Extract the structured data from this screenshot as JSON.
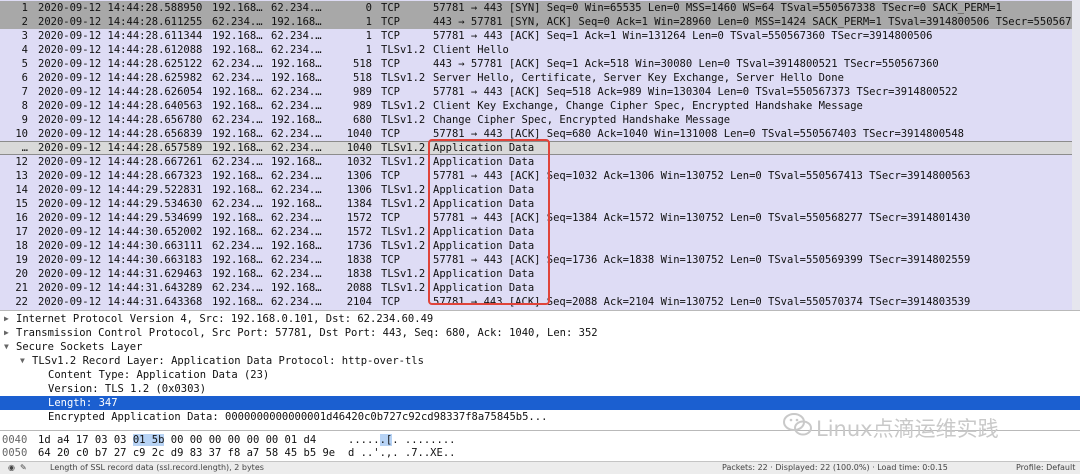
{
  "packets": [
    {
      "no": "1",
      "time": "2020-09-12 14:44:28.588950",
      "src": "192.168…",
      "dst": "62.234.…",
      "len": "0",
      "proto": "TCP",
      "info": "57781 → 443 [SYN] Seq=0 Win=65535 Len=0 MSS=1460 WS=64 TSval=550567338 TSecr=0 SACK_PERM=1",
      "style": "syn"
    },
    {
      "no": "2",
      "time": "2020-09-12 14:44:28.611255",
      "src": "62.234.…",
      "dst": "192.168…",
      "len": "1",
      "proto": "TCP",
      "info": "443 → 57781 [SYN, ACK] Seq=0 Ack=1 Win=28960 Len=0 MSS=1424 SACK_PERM=1 TSval=3914800506 TSecr=550567338",
      "style": "syn"
    },
    {
      "no": "3",
      "time": "2020-09-12 14:44:28.611344",
      "src": "192.168…",
      "dst": "62.234.…",
      "len": "1",
      "proto": "TCP",
      "info": "57781 → 443 [ACK] Seq=1 Ack=1 Win=131264 Len=0 TSval=550567360 TSecr=3914800506",
      "style": ""
    },
    {
      "no": "4",
      "time": "2020-09-12 14:44:28.612088",
      "src": "192.168…",
      "dst": "62.234.…",
      "len": "1",
      "proto": "TLSv1.2",
      "info": "Client Hello",
      "style": ""
    },
    {
      "no": "5",
      "time": "2020-09-12 14:44:28.625122",
      "src": "62.234.…",
      "dst": "192.168…",
      "len": "518",
      "proto": "TCP",
      "info": "443 → 57781 [ACK] Seq=1 Ack=518 Win=30080 Len=0 TSval=3914800521 TSecr=550567360",
      "style": ""
    },
    {
      "no": "6",
      "time": "2020-09-12 14:44:28.625982",
      "src": "62.234.…",
      "dst": "192.168…",
      "len": "518",
      "proto": "TLSv1.2",
      "info": "Server Hello, Certificate, Server Key Exchange, Server Hello Done",
      "style": ""
    },
    {
      "no": "7",
      "time": "2020-09-12 14:44:28.626054",
      "src": "192.168…",
      "dst": "62.234.…",
      "len": "989",
      "proto": "TCP",
      "info": "57781 → 443 [ACK] Seq=518 Ack=989 Win=130304 Len=0 TSval=550567373 TSecr=3914800522",
      "style": ""
    },
    {
      "no": "8",
      "time": "2020-09-12 14:44:28.640563",
      "src": "192.168…",
      "dst": "62.234.…",
      "len": "989",
      "proto": "TLSv1.2",
      "info": "Client Key Exchange, Change Cipher Spec, Encrypted Handshake Message",
      "style": ""
    },
    {
      "no": "9",
      "time": "2020-09-12 14:44:28.656780",
      "src": "62.234.…",
      "dst": "192.168…",
      "len": "680",
      "proto": "TLSv1.2",
      "info": "Change Cipher Spec, Encrypted Handshake Message",
      "style": ""
    },
    {
      "no": "10",
      "time": "2020-09-12 14:44:28.656839",
      "src": "192.168…",
      "dst": "62.234.…",
      "len": "1040",
      "proto": "TCP",
      "info": "57781 → 443 [ACK] Seq=680 Ack=1040 Win=131008 Len=0 TSval=550567403 TSecr=3914800548",
      "style": ""
    },
    {
      "no": "…",
      "time": "2020-09-12 14:44:28.657589",
      "src": "192.168…",
      "dst": "62.234.…",
      "len": "1040",
      "proto": "TLSv1.2",
      "info": "Application Data",
      "style": "sel"
    },
    {
      "no": "12",
      "time": "2020-09-12 14:44:28.667261",
      "src": "62.234.…",
      "dst": "192.168…",
      "len": "1032",
      "proto": "TLSv1.2",
      "info": "Application Data",
      "style": ""
    },
    {
      "no": "13",
      "time": "2020-09-12 14:44:28.667323",
      "src": "192.168…",
      "dst": "62.234.…",
      "len": "1306",
      "proto": "TCP",
      "info": "57781 → 443 [ACK] Seq=1032 Ack=1306 Win=130752 Len=0 TSval=550567413 TSecr=3914800563",
      "style": ""
    },
    {
      "no": "14",
      "time": "2020-09-12 14:44:29.522831",
      "src": "192.168…",
      "dst": "62.234.…",
      "len": "1306",
      "proto": "TLSv1.2",
      "info": "Application Data",
      "style": ""
    },
    {
      "no": "15",
      "time": "2020-09-12 14:44:29.534630",
      "src": "62.234.…",
      "dst": "192.168…",
      "len": "1384",
      "proto": "TLSv1.2",
      "info": "Application Data",
      "style": ""
    },
    {
      "no": "16",
      "time": "2020-09-12 14:44:29.534699",
      "src": "192.168…",
      "dst": "62.234.…",
      "len": "1572",
      "proto": "TCP",
      "info": "57781 → 443 [ACK] Seq=1384 Ack=1572 Win=130752 Len=0 TSval=550568277 TSecr=3914801430",
      "style": ""
    },
    {
      "no": "17",
      "time": "2020-09-12 14:44:30.652002",
      "src": "192.168…",
      "dst": "62.234.…",
      "len": "1572",
      "proto": "TLSv1.2",
      "info": "Application Data",
      "style": ""
    },
    {
      "no": "18",
      "time": "2020-09-12 14:44:30.663111",
      "src": "62.234.…",
      "dst": "192.168…",
      "len": "1736",
      "proto": "TLSv1.2",
      "info": "Application Data",
      "style": ""
    },
    {
      "no": "19",
      "time": "2020-09-12 14:44:30.663183",
      "src": "192.168…",
      "dst": "62.234.…",
      "len": "1838",
      "proto": "TCP",
      "info": "57781 → 443 [ACK] Seq=1736 Ack=1838 Win=130752 Len=0 TSval=550569399 TSecr=3914802559",
      "style": ""
    },
    {
      "no": "20",
      "time": "2020-09-12 14:44:31.629463",
      "src": "192.168…",
      "dst": "62.234.…",
      "len": "1838",
      "proto": "TLSv1.2",
      "info": "Application Data",
      "style": ""
    },
    {
      "no": "21",
      "time": "2020-09-12 14:44:31.643289",
      "src": "62.234.…",
      "dst": "192.168…",
      "len": "2088",
      "proto": "TLSv1.2",
      "info": "Application Data",
      "style": ""
    },
    {
      "no": "22",
      "time": "2020-09-12 14:44:31.643368",
      "src": "192.168…",
      "dst": "62.234.…",
      "len": "2104",
      "proto": "TCP",
      "info": "57781 → 443 [ACK] Seq=2088 Ack=2104 Win=130752 Len=0 TSval=550570374 TSecr=3914803539",
      "style": ""
    }
  ],
  "details": [
    {
      "text": "Internet Protocol Version 4, Src: 192.168.0.101, Dst: 62.234.60.49",
      "level": 0,
      "tri": "▶",
      "selected": false
    },
    {
      "text": "Transmission Control Protocol, Src Port: 57781, Dst Port: 443, Seq: 680, Ack: 1040, Len: 352",
      "level": 0,
      "tri": "▶",
      "selected": false
    },
    {
      "text": "Secure Sockets Layer",
      "level": 0,
      "tri": "▼",
      "selected": false
    },
    {
      "text": "TLSv1.2 Record Layer: Application Data Protocol: http-over-tls",
      "level": 1,
      "tri": "▼",
      "selected": false
    },
    {
      "text": "Content Type: Application Data (23)",
      "level": 2,
      "tri": "",
      "selected": false
    },
    {
      "text": "Version: TLS 1.2 (0x0303)",
      "level": 2,
      "tri": "",
      "selected": false
    },
    {
      "text": "Length: 347",
      "level": 2,
      "tri": "",
      "selected": true
    },
    {
      "text": "Encrypted Application Data: 0000000000000001d46420c0b727c92cd98337f8a75845b5...",
      "level": 2,
      "tri": "",
      "selected": false
    }
  ],
  "hex": [
    {
      "offset": "0040",
      "pre": "1d a4 17 03 03 ",
      "hl": "01 5b",
      "post": " 00  00 00 00 00 00 01 d4",
      "ascii_pre": ".....",
      "ascii_hl": ".[",
      "ascii_post": ". ........"
    },
    {
      "offset": "0050",
      "pre": "64 20 c0 b7 27 c9 2c d9  83 37 f8 a7 58 45 b5 9e",
      "hl": "",
      "post": "",
      "ascii_pre": "d ..'.,. .7..XE..",
      "ascii_hl": "",
      "ascii_post": ""
    }
  ],
  "watermark": {
    "text": "Linux点滴运维实践",
    "icon": "wechat-icon"
  },
  "status": {
    "left": "Length of SSL record data (ssl.record.length), 2 bytes",
    "middle": "Packets: 22 · Displayed: 22 (100.0%) · Load time: 0:0.15",
    "right": "Profile: Default"
  },
  "colors": {
    "list_bg": "#dedcf5",
    "syn_row": "#a8a8a8",
    "selected_detail": "#1b5fd0",
    "hex_highlight": "#b7d3f5",
    "annotation_box": "#e0443a"
  }
}
